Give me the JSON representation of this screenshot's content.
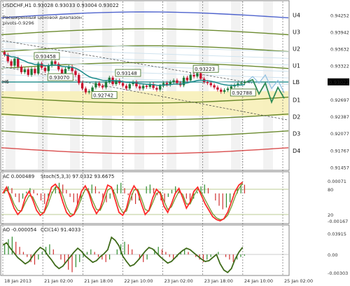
{
  "header": {
    "title_line": "USDCHF,H1 0.93028 0.93033 0.93004 0.93022",
    "subtitle_1": "Расширенный ценовой диапазон",
    "subtitle_2": "pivots-0.9296"
  },
  "colors": {
    "background": "#ffffff",
    "candle_up": "#1f7a3a",
    "candle_down": "#c8102e",
    "band_fill": "#f7f0b8",
    "pivot_blue": "#3b52c8",
    "pivot_green": "#5c7e1a",
    "pivot_red": "#d53a3a",
    "ema_teal": "#1a8a8a",
    "forecast": "#2e8b57",
    "forecast_ghost": "#8fbfe0",
    "ac_up": "#2e8b2e",
    "ac_down": "#d03030",
    "stoch_main": "#ff2a2a",
    "stoch_signal": "#6b8f1f",
    "cci_line": "#3f6b1a",
    "ao_up": "#2e8b2e",
    "ao_down": "#d03030"
  },
  "chart_data": [
    {
      "type": "line",
      "panel": "main",
      "symbol": "USDCHF,H1",
      "ohlc_last": {
        "open": 0.93028,
        "high": 0.93033,
        "low": 0.93004,
        "close": 0.93022
      },
      "current_price_label": "0.93022",
      "y_ticks": [
        "0.94252",
        "0.93942",
        "0.93632",
        "0.93322",
        "0.93012",
        "0.92697",
        "0.92387",
        "0.92077",
        "0.91767",
        "0.91457"
      ],
      "ylim": [
        0.9141,
        0.945
      ],
      "x_ticks": [
        "18 Jan 2013",
        "21 Jan 02:00",
        "21 Jan 18:00",
        "22 Jan 10:00",
        "23 Jan 02:00",
        "23 Jan 18:00",
        "24 Jan 10:00",
        "25 Jan 02:00"
      ],
      "levels": [
        {
          "name": "U4",
          "value": 0.9425
        },
        {
          "name": "U3",
          "value": 0.9394
        },
        {
          "name": "U2",
          "value": 0.9363
        },
        {
          "name": "U1",
          "value": 0.9332
        },
        {
          "name": "LB",
          "value": 0.9302
        },
        {
          "name": "D1",
          "value": 0.9269
        },
        {
          "name": "D2",
          "value": 0.9238
        },
        {
          "name": "D3",
          "value": 0.9207
        },
        {
          "name": "D4",
          "value": 0.9176
        }
      ],
      "side_label": "H6",
      "annotations": [
        {
          "text": "0.93458",
          "x": 9,
          "y": 0.93458
        },
        {
          "text": "0.93070",
          "x": 13,
          "y": 0.9307
        },
        {
          "text": "0.93148",
          "x": 33,
          "y": 0.93148
        },
        {
          "text": "0.92742",
          "x": 26,
          "y": 0.92742
        },
        {
          "text": "0.93223",
          "x": 56,
          "y": 0.93223
        },
        {
          "text": "0.92788",
          "x": 67,
          "y": 0.92788
        }
      ],
      "closes": [
        0.9352,
        0.934,
        0.9332,
        0.9345,
        0.933,
        0.932,
        0.9325,
        0.9315,
        0.9326,
        0.9318,
        0.9336,
        0.9328,
        0.9322,
        0.9332,
        0.934,
        0.9335,
        0.9325,
        0.9318,
        0.9326,
        0.933,
        0.9322,
        0.9315,
        0.93,
        0.929,
        0.9283,
        0.9285,
        0.9292,
        0.93,
        0.9295,
        0.9292,
        0.9302,
        0.931,
        0.9298,
        0.9305,
        0.93,
        0.9295,
        0.929,
        0.9298,
        0.9302,
        0.9294,
        0.929,
        0.9295,
        0.9293,
        0.9298,
        0.9291,
        0.9288,
        0.9295,
        0.93,
        0.9297,
        0.9302,
        0.9305,
        0.93,
        0.9296,
        0.931,
        0.9305,
        0.9315,
        0.9312,
        0.9318,
        0.9308,
        0.9302,
        0.93,
        0.9296,
        0.9292,
        0.9288,
        0.9284,
        0.9287,
        0.929,
        0.9294,
        0.9296,
        0.9299,
        0.93,
        0.9302
      ]
    },
    {
      "type": "bar",
      "panel": "ac_stoch",
      "label": "AC 0.000489",
      "stoch_label": "Stoch(5,3,3) 97.0332 93.6675",
      "right_ticks": [
        "0.00071",
        "80",
        "20",
        "-0.00167"
      ],
      "left_ylim": [
        -0.00167,
        0.00071
      ],
      "stoch_levels": [
        80,
        20
      ],
      "ac_values": [
        0.0002,
        0.0004,
        0.0003,
        -0.0002,
        -0.0005,
        -0.0003,
        0.0001,
        0.0003,
        0.0002,
        -0.0001,
        -0.0004,
        -0.0006,
        -0.0004,
        0.0001,
        0.0004,
        0.0006,
        0.0005,
        0.0002,
        -0.0002,
        -0.0005,
        -0.0007,
        -0.0004,
        0.0,
        0.0003,
        0.0005,
        0.0004,
        0.0001,
        -0.0003,
        -0.0005,
        -0.0003,
        0.0002,
        0.0005,
        0.0006,
        0.0003,
        -0.0001,
        -0.0004,
        -0.0006,
        -0.0004,
        0.0,
        0.0004,
        0.0005,
        0.0003,
        -0.0001,
        -0.0004,
        -0.0005,
        -0.0002,
        0.0002,
        0.0004,
        0.0003,
        0.0,
        -0.0003,
        -0.0005,
        -0.0003,
        0.0001,
        0.0004,
        0.0005,
        0.0003,
        0.0,
        -0.0004,
        -0.0007,
        -0.0009,
        -0.0008,
        -0.0005,
        -0.0001,
        0.0003,
        0.0005,
        0.00049
      ],
      "stoch_main": [
        70,
        85,
        60,
        35,
        20,
        30,
        60,
        75,
        55,
        30,
        18,
        25,
        55,
        85,
        92,
        80,
        50,
        25,
        15,
        20,
        45,
        75,
        88,
        70,
        40,
        22,
        35,
        65,
        90,
        85,
        55,
        25,
        18,
        35,
        70,
        88,
        75,
        45,
        20,
        30,
        60,
        80,
        70,
        40,
        25,
        45,
        70,
        82,
        60,
        35,
        50,
        75,
        85,
        65,
        45,
        30,
        15,
        8,
        5,
        10,
        25,
        50,
        75,
        90,
        97
      ],
      "stoch_signal": [
        72,
        78,
        68,
        45,
        30,
        28,
        48,
        65,
        62,
        42,
        25,
        24,
        42,
        68,
        85,
        84,
        65,
        38,
        22,
        20,
        35,
        60,
        80,
        75,
        52,
        32,
        30,
        50,
        78,
        84,
        68,
        40,
        25,
        28,
        55,
        78,
        80,
        58,
        32,
        28,
        48,
        70,
        74,
        52,
        32,
        38,
        58,
        75,
        68,
        45,
        45,
        65,
        80,
        72,
        55,
        38,
        22,
        12,
        8,
        9,
        18,
        38,
        62,
        82,
        94
      ]
    },
    {
      "type": "bar",
      "panel": "ao_cci",
      "label": "AO -0.000054",
      "cci_label": "CCI(14) 91.4033",
      "right_ticks": [
        "0.03915",
        "0.00",
        "-0.00303"
      ],
      "ao_values": [
        0.0004,
        0.0006,
        0.0007,
        0.0005,
        0.0003,
        0.0001,
        -0.0001,
        -0.0003,
        -0.0004,
        -0.0002,
        0.0001,
        0.0003,
        0.0004,
        0.0002,
        0.0,
        -0.0002,
        -0.0004,
        -0.0006,
        -0.0007,
        -0.0005,
        -0.0003,
        -0.0001,
        0.0001,
        0.0002,
        0.0001,
        -0.0001,
        -0.0002,
        -0.0003,
        -0.0002,
        0.0,
        0.0002,
        0.0004,
        0.0005,
        0.0004,
        0.0002,
        0.0,
        -0.0002,
        -0.0003,
        -0.0002,
        0.0,
        0.0002,
        0.0003,
        0.0002,
        0.0001,
        -0.0001,
        -0.0002,
        -0.0001,
        0.0001,
        0.0002,
        0.0001,
        0.0,
        -0.0001,
        -0.0002,
        -0.0003,
        -0.0002,
        -0.0001,
        0.0,
        0.0001,
        0.0,
        -0.0001,
        -0.0002,
        -0.0003,
        -0.0002,
        -0.0001,
        -5e-05
      ],
      "cci_values": [
        120,
        150,
        80,
        20,
        -40,
        -80,
        -120,
        -90,
        -20,
        40,
        90,
        60,
        -10,
        -70,
        -140,
        -180,
        -150,
        -90,
        -30,
        30,
        80,
        40,
        -20,
        -60,
        -100,
        -80,
        -30,
        10,
        60,
        220,
        180,
        110,
        -20,
        -90,
        -150,
        -130,
        -80,
        -20,
        40,
        90,
        70,
        20,
        -30,
        -70,
        -110,
        -90,
        -40,
        10,
        50,
        80,
        60,
        20,
        -20,
        -60,
        -90,
        -80,
        -40,
        0,
        -120,
        -200,
        -230,
        -180,
        -60,
        30,
        91.4
      ]
    }
  ]
}
